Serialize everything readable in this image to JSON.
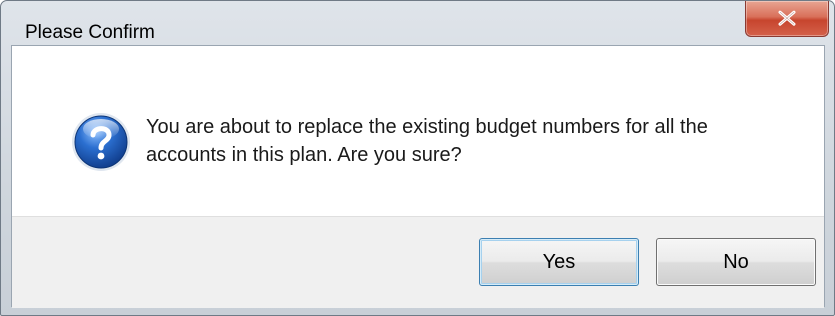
{
  "window": {
    "title": "Please Confirm"
  },
  "icons": {
    "message_icon": "question-icon",
    "close_icon": "close-icon"
  },
  "message": {
    "line1": "You are about to replace the existing budget numbers for all the",
    "line2": "accounts in this plan.  Are you sure?"
  },
  "buttons": {
    "yes_label": "Yes",
    "no_label": "No"
  },
  "colors": {
    "close_button": "#c7452e",
    "question_icon": "#2b6fd0",
    "focus_border": "#3c7fb1"
  }
}
